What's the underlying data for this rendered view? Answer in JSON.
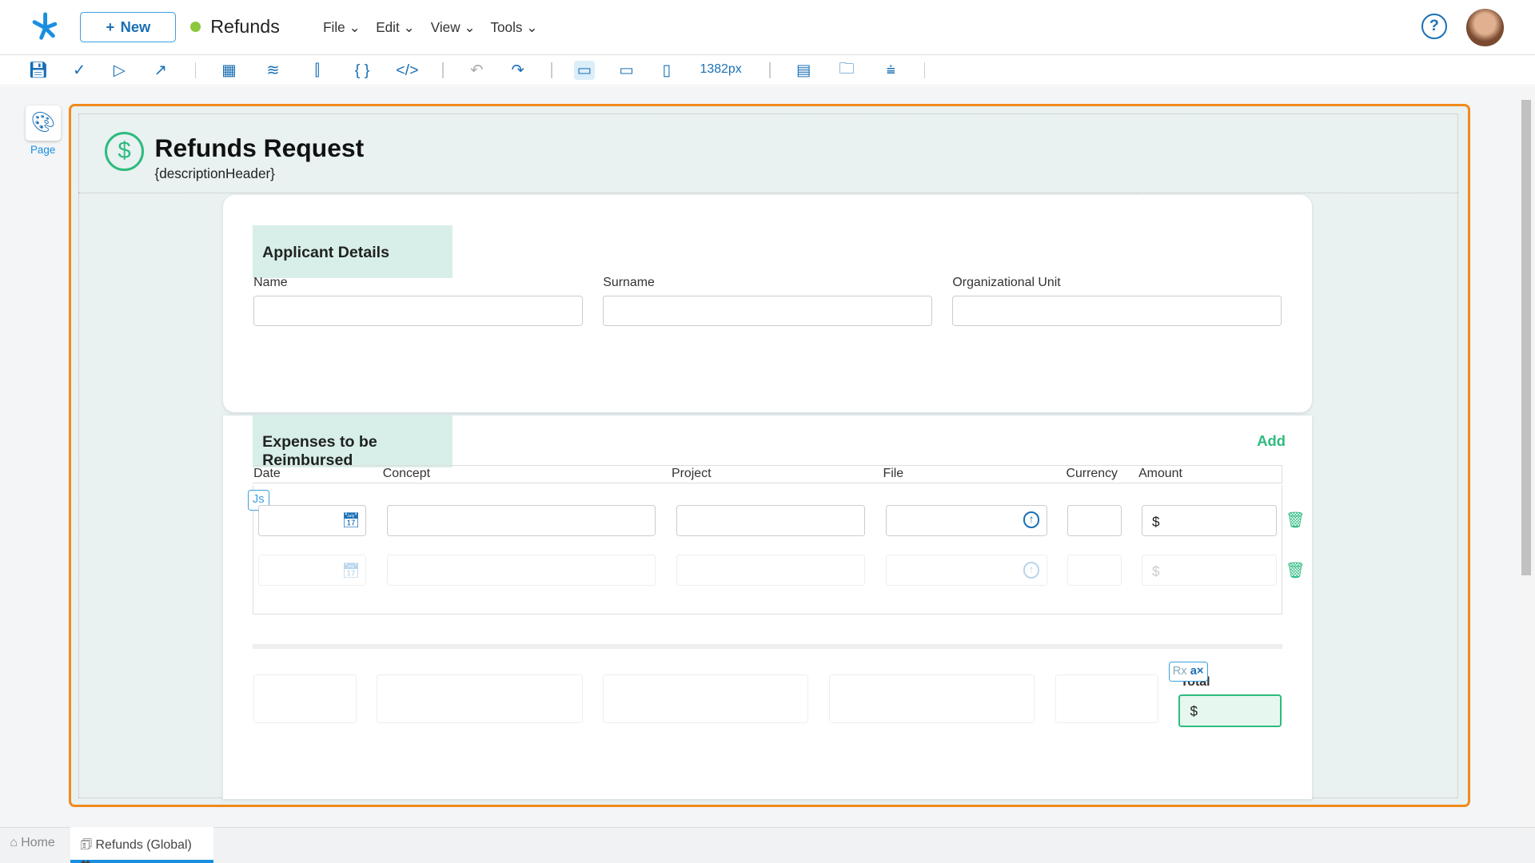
{
  "header": {
    "new_label": "New",
    "app_title": "Refunds",
    "status_color": "#8dc63f",
    "menus": [
      "File",
      "Edit",
      "View",
      "Tools"
    ]
  },
  "toolbar": {
    "width_readout": "1382px",
    "icons": [
      "save-icon",
      "check-icon",
      "play-icon",
      "export-icon",
      "components-icon",
      "layers-icon",
      "data-icon",
      "braces-icon",
      "code-icon",
      "undo-icon",
      "redo-icon",
      "desktop-icon",
      "tablet-icon",
      "mobile-icon",
      "header-layout-icon",
      "folder-layout-icon",
      "align-icon"
    ]
  },
  "sidebar": {
    "page_label": "Page"
  },
  "form": {
    "title": "Refunds Request",
    "subtitle": "{descriptionHeader}",
    "applicant": {
      "title": "Applicant Details",
      "fields": [
        "Name",
        "Surname",
        "Organizational Unit"
      ]
    },
    "expenses": {
      "title": "Expenses to be Reimbursed",
      "add_label": "Add",
      "columns": [
        "Date",
        "Concept",
        "Project",
        "File",
        "Currency",
        "Amount"
      ],
      "currency_symbol": "$",
      "js_badge": "Js"
    },
    "total": {
      "label": "Total",
      "value": "$",
      "rx_badge": "Rx"
    }
  },
  "tabs": {
    "home": "Home",
    "active": "Refunds (Global)"
  },
  "colors": {
    "accent": "#f08a1c",
    "brand": "#1a6fb5",
    "green": "#2dbb7f"
  }
}
